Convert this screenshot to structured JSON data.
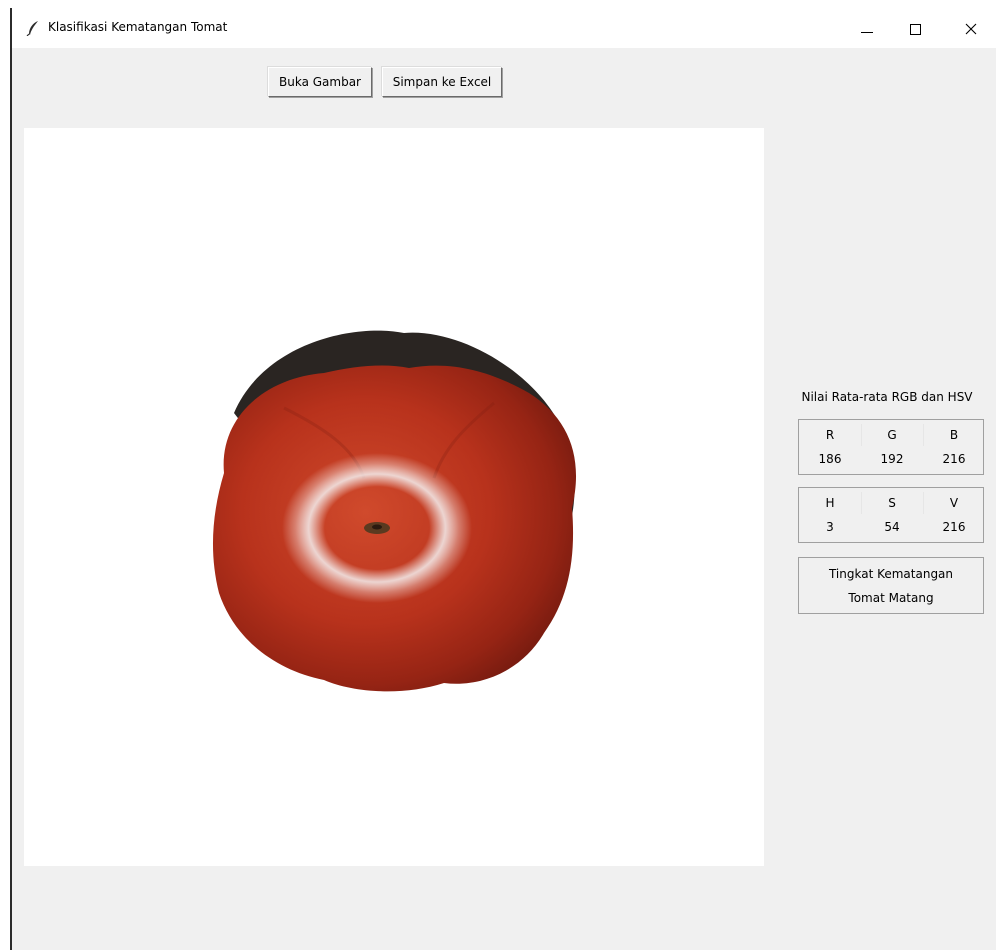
{
  "window": {
    "title": "Klasifikasi Kematangan Tomat",
    "controls": {
      "minimize": "minimize-icon",
      "maximize": "maximize-icon",
      "close": "close-icon"
    }
  },
  "toolbar": {
    "open_image_label": "Buka Gambar",
    "save_excel_label": "Simpan ke Excel"
  },
  "image_panel": {
    "content": "tomato-photo",
    "background": "#ffffff"
  },
  "results": {
    "title": "Nilai Rata-rata RGB dan HSV",
    "rgb": {
      "headers": [
        "R",
        "G",
        "B"
      ],
      "values": [
        "186",
        "192",
        "216"
      ]
    },
    "hsv": {
      "headers": [
        "H",
        "S",
        "V"
      ],
      "values": [
        "3",
        "54",
        "216"
      ]
    },
    "ripeness": {
      "label": "Tingkat Kematangan",
      "value": "Tomat Matang"
    }
  },
  "colors": {
    "window_bg": "#f0f0f0",
    "tomato_red": "#b8321c",
    "tomato_shadow": "#2a2522"
  }
}
